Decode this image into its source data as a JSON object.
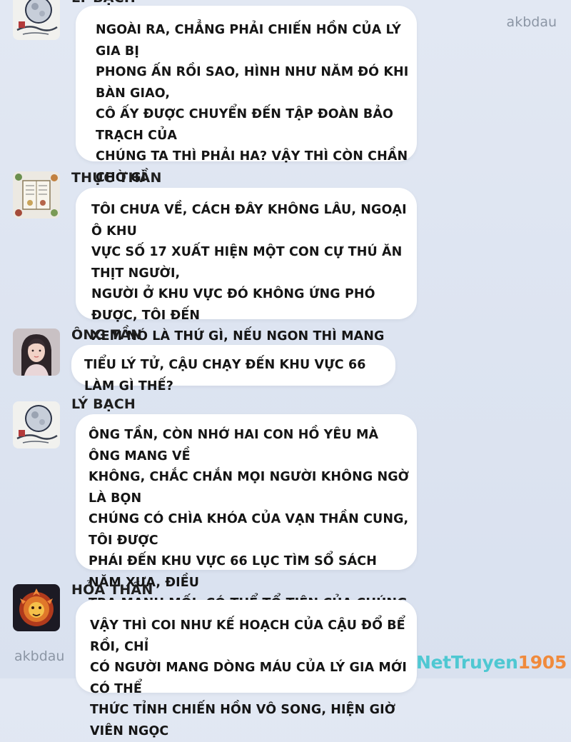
{
  "messages": [
    {
      "name": "LÝ BẠCH",
      "avatar_icon": "moon-ink-avatar-icon",
      "text": "NGOÀI RA, CHẲNG PHẢI CHIẾN HỒN CỦA LÝ GIA BỊ\nPHONG ẤN RỒI SAO, HÌNH NHƯ NĂM ĐÓ KHI BÀN GIAO,\nCÔ ẤY ĐƯỢC CHUYỂN ĐẾN TẬP ĐOÀN BẢO TRẠCH CỦA\nCHÚNG TA THÌ PHẢI HA? VẬY THÌ CÒN CHẦN CHỜ GÌ\nNỮA, TRỰC TIẾP THỨC TỈNH CÔ ẤY ĐI, ĐẠI LÃO TÔI ĐÂY\nĐỠ PHẢI CHẠY ĐẾN KHU VỰC SỐ 66 LÀM NHIỆM VỤ."
    },
    {
      "name": "THỰC THẦN",
      "avatar_icon": "recipe-book-avatar-icon",
      "text": "TÔI CHƯA VỀ, CÁCH ĐÂY KHÔNG LÂU, NGOẠI Ô KHU\nVỰC SỐ 17 XUẤT HIỆN MỘT CON CỰ THÚ ĂN THỊT NGƯỜI,\nNGƯỜI Ở KHU VỰC ĐÓ KHÔNG ỨNG PHÓ ĐƯỢC, TÔI ĐẾN\nXEM NÓ LÀ THỨ GÌ, NẾU NGON THÌ MANG VÀI CÂN THỊT\nVỀ CHO MỌI NGƯỜI."
    },
    {
      "name": "ÔNG TẦN",
      "avatar_icon": "woman-portrait-avatar-icon",
      "text": "TIỂU LÝ TỬ, CẬU CHẠY ĐẾN KHU VỰC 66 LÀM GÌ THẾ?"
    },
    {
      "name": "LÝ BẠCH",
      "avatar_icon": "moon-ink-avatar-icon",
      "text": "ÔNG TẦN, CÒN NHỚ HAI CON HỒ YÊU MÀ ÔNG MANG VỀ\nKHÔNG, CHẮC CHẮN MỌI NGƯỜI KHÔNG NGỜ LÀ BỌN\nCHÚNG CÓ CHÌA KHÓA CỦA VẠN THẦN CUNG, TÔI ĐƯỢC\nPHÁI ĐẾN KHU VỰC 66 LỤC TÌM SỔ SÁCH NĂM XƯA, ĐIỀU\nTRA MANH MỐI. CÓ THỂ TỔ TIÊN CỦA CHÚNG CÓ LIÊN\nQUAN ĐẾN YÊU ĐẠO."
    },
    {
      "name": "HỎA THẦN",
      "avatar_icon": "fire-lion-avatar-icon",
      "text": "VẬY THÌ COI NHƯ KẾ HOẠCH CỦA CẬU ĐỔ BỂ RỒI, CHỈ\nCÓ NGƯỜI MANG DÒNG MÁU CỦA LÝ GIA MỚI CÓ THỂ\nTHỨC TỈNH CHIẾN HỒN VÔ SONG, HIỆN GIỜ VIÊN NGỌC"
    }
  ],
  "watermarks": {
    "top_right": "akbdau",
    "bottom_left": "akbdau",
    "brand_part1": "NetTruyen",
    "brand_part2": "1905"
  },
  "colors": {
    "background": "#dde4f1",
    "bubble": "#ffffff",
    "text": "#151515",
    "brand_teal": "#4fc8d2",
    "brand_orange": "#f08a3c"
  }
}
